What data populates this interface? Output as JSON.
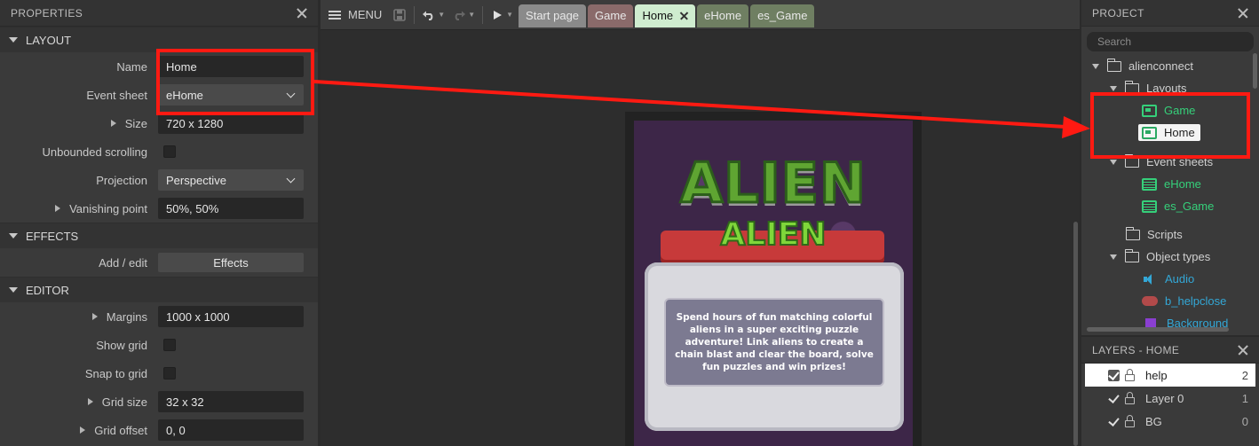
{
  "properties": {
    "title": "PROPERTIES",
    "sections": {
      "layout": "LAYOUT",
      "effects": "EFFECTS",
      "editor": "EDITOR"
    },
    "layout": {
      "name_label": "Name",
      "name_value": "Home",
      "event_sheet_label": "Event sheet",
      "event_sheet_value": "eHome",
      "size_label": "Size",
      "size_value": "720 x 1280",
      "unbounded_label": "Unbounded scrolling",
      "projection_label": "Projection",
      "projection_value": "Perspective",
      "vanishing_label": "Vanishing point",
      "vanishing_value": "50%, 50%"
    },
    "effects": {
      "add_edit_label": "Add / edit",
      "effects_button": "Effects"
    },
    "editor": {
      "margins_label": "Margins",
      "margins_value": "1000 x 1000",
      "show_grid_label": "Show grid",
      "snap_label": "Snap to grid",
      "grid_size_label": "Grid size",
      "grid_size_value": "32 x 32",
      "grid_offset_label": "Grid offset",
      "grid_offset_value": "0, 0"
    }
  },
  "toolbar": {
    "menu_label": "MENU",
    "tabs": [
      {
        "label": "Start page",
        "color": "#8a8a8a"
      },
      {
        "label": "Game",
        "color": "#8a6a6a"
      },
      {
        "label": "Home",
        "color": "#cfeccf"
      },
      {
        "label": "eHome",
        "color": "#6f7f62"
      },
      {
        "label": "es_Game",
        "color": "#6f7f62"
      }
    ]
  },
  "game": {
    "logo_big": "ALIEN",
    "logo_small": "ALIEN",
    "description": "Spend hours of fun matching colorful aliens in a super exciting puzzle adventure! Link aliens to create a chain blast and clear the board, solve fun  puzzles and win prizes!"
  },
  "project": {
    "title": "PROJECT",
    "search_placeholder": "Search",
    "root": "alienconnect",
    "layouts_folder": "Layouts",
    "layouts": [
      "Game",
      "Home"
    ],
    "event_sheets_folder": "Event sheets",
    "event_sheets": [
      "eHome",
      "es_Game"
    ],
    "scripts_folder": "Scripts",
    "object_types_folder": "Object types",
    "objects": [
      "Audio",
      "b_helpclose",
      "Background"
    ]
  },
  "layers": {
    "title": "LAYERS - HOME",
    "items": [
      {
        "name": "help",
        "count": "2"
      },
      {
        "name": "Layer 0",
        "count": "1"
      },
      {
        "name": "BG",
        "count": "0"
      }
    ]
  },
  "colors": {
    "highlight": "#ff1a12",
    "tree_green": "#35d07a",
    "tree_cyan": "#33a7d6"
  }
}
